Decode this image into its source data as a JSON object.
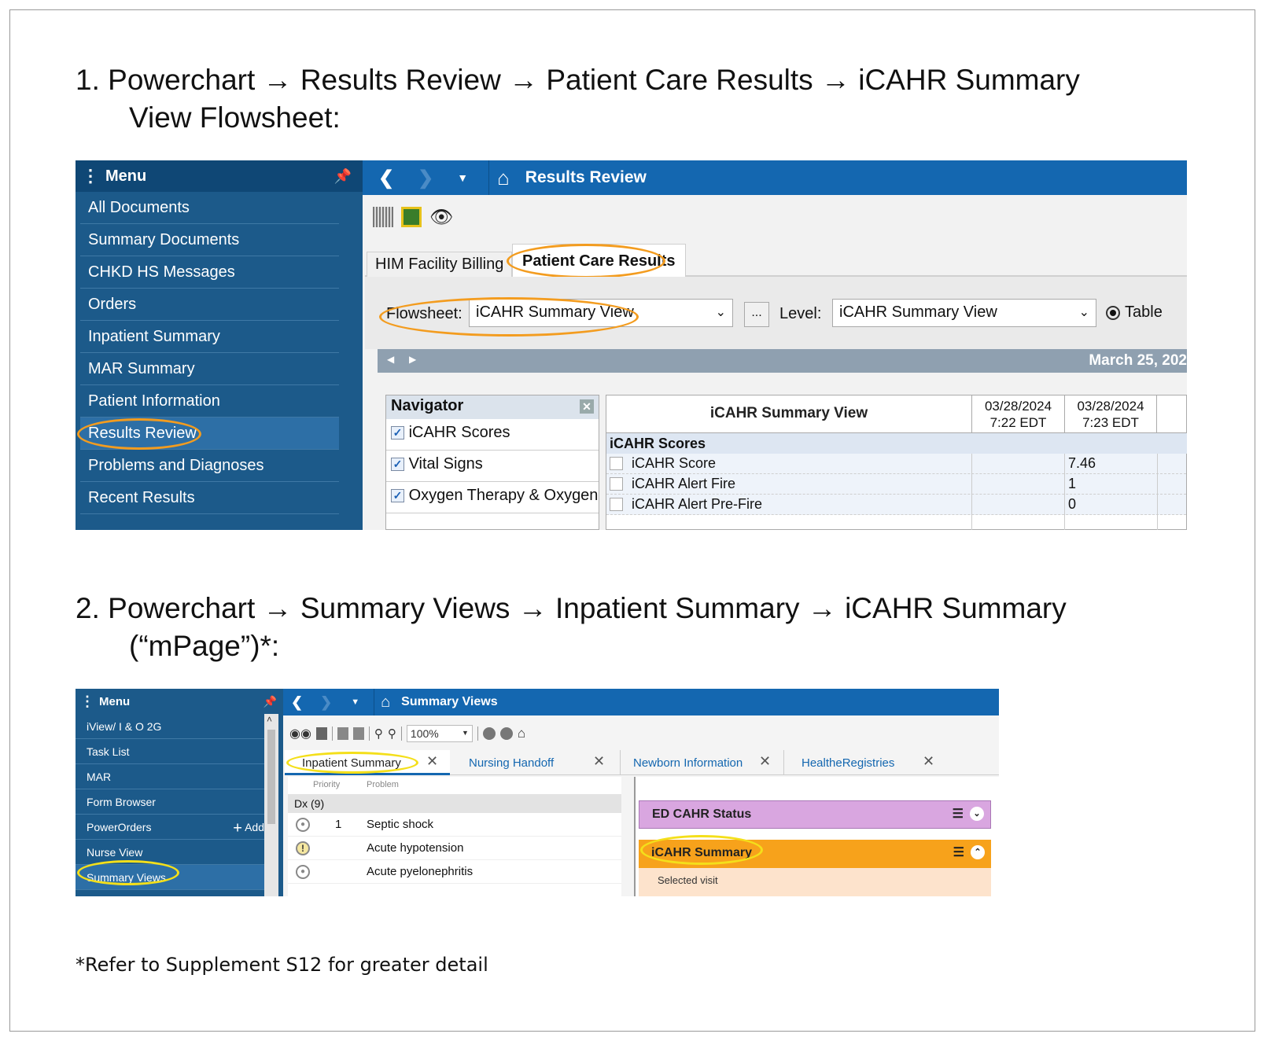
{
  "step1": {
    "line1": "1. Powerchart  → Results Review → Patient Care Results → iCAHR Summary",
    "line2": "View Flowsheet:"
  },
  "shot1": {
    "menu_title": "Menu",
    "menu_items": [
      "All Documents",
      "Summary Documents",
      "CHKD HS Messages",
      "Orders",
      "Inpatient Summary",
      "MAR Summary",
      "Patient Information",
      "Results Review",
      "Problems and Diagnoses",
      "Recent Results"
    ],
    "page_title": "Results Review",
    "tabs": [
      "HIM Facility Billing",
      "Patient Care Results"
    ],
    "flowsheet_label": "Flowsheet:",
    "flowsheet_value": "iCAHR Summary View",
    "ellipsis_label": "...",
    "level_label": "Level:",
    "level_value": "iCAHR Summary View",
    "table_radio_label": "Table",
    "date_banner": "March 25, 202",
    "navigator_title": "Navigator",
    "navigator_items": [
      "iCAHR Scores",
      "Vital Signs",
      "Oxygen Therapy & Oxygen"
    ],
    "grid_title": "iCAHR Summary View",
    "grid_cols": [
      {
        "date": "03/28/2024",
        "time": "7:22 EDT"
      },
      {
        "date": "03/28/2024",
        "time": "7:23 EDT"
      }
    ],
    "grid_section": "iCAHR Scores",
    "grid_rows": [
      {
        "name": "iCAHR Score",
        "v1": "",
        "v2": "7.46"
      },
      {
        "name": "iCAHR Alert Fire",
        "v1": "",
        "v2": "1"
      },
      {
        "name": "iCAHR Alert Pre-Fire",
        "v1": "",
        "v2": "0"
      }
    ]
  },
  "step2": {
    "line1": "2. Powerchart → Summary Views → Inpatient Summary → iCAHR Summary",
    "line2": "(“mPage”)*:"
  },
  "shot2": {
    "menu_title": "Menu",
    "menu_items": [
      "iView/ I & O 2G",
      "Task List",
      "MAR",
      "Form Browser",
      "PowerOrders",
      "Nurse View",
      "Summary Views"
    ],
    "add_label": "Add",
    "page_title": "Summary Views",
    "zoom": "100%",
    "tabs": [
      "Inpatient Summary",
      "Nursing Handoff",
      "Newborn Information",
      "HealtheRegistries"
    ],
    "col_priority": "Priority",
    "col_problem": "Problem",
    "dx_label": "Dx (9)",
    "problems": [
      {
        "priority": "1",
        "name": "Septic shock"
      },
      {
        "priority": "",
        "name": "Acute hypotension"
      },
      {
        "priority": "",
        "name": "Acute pyelonephritis"
      }
    ],
    "ed_status": "ED CAHR Status",
    "icahr_summary": "iCAHR Summary",
    "selected_visit": "Selected visit"
  },
  "footnote": "*Refer to Supplement S12 for greater detail",
  "colors": {
    "menu_bg": "#1c5a8a",
    "topbar_bg": "#1467b0",
    "highlight_orange": "#f39c1f",
    "highlight_yellow": "#f4df1a",
    "ed_status_bg": "#d9a6e0",
    "icahr_bg": "#f7a21b"
  }
}
